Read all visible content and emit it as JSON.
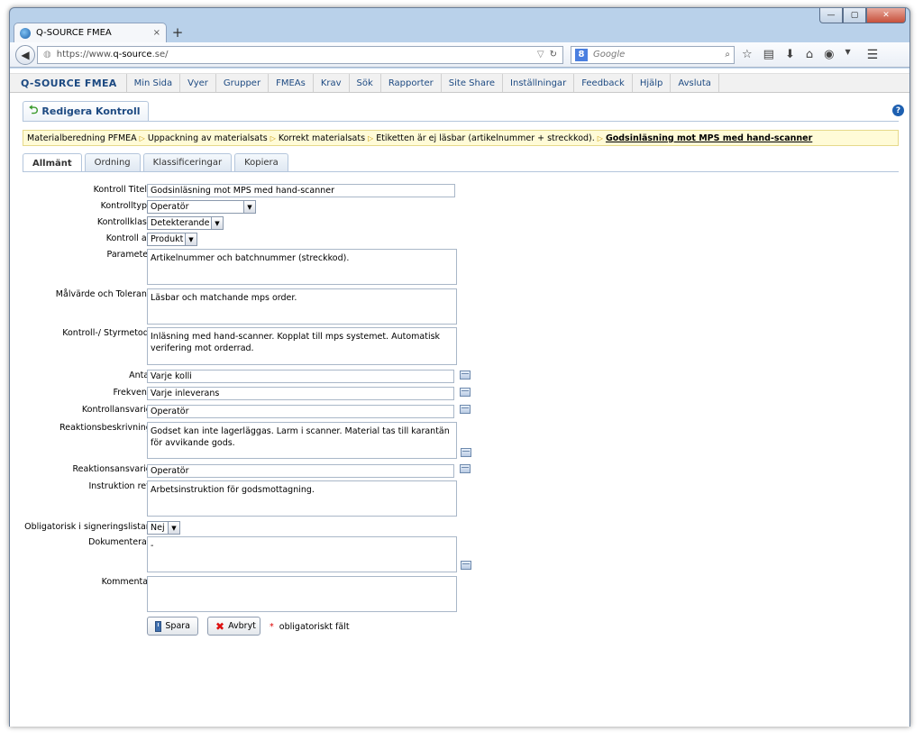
{
  "browser": {
    "tab_title": "Q-SOURCE FMEA",
    "tab_close": "×",
    "new_tab": "+",
    "url_prefix": "https://www.",
    "url_domain": "q-source",
    "url_suffix": ".se/",
    "search_placeholder": "Google",
    "search_engine_letter": "8"
  },
  "appmenu": {
    "brand": "Q-SOURCE FMEA",
    "items": [
      "Min Sida",
      "Vyer",
      "Grupper",
      "FMEAs",
      "Krav",
      "Sök",
      "Rapporter",
      "Site Share",
      "Inställningar",
      "Feedback",
      "Hjälp",
      "Avsluta"
    ]
  },
  "header": {
    "title": "Redigera Kontroll",
    "help": "?"
  },
  "breadcrumb": {
    "items": [
      "Materialberedning PFMEA",
      "Uppackning av materialsats",
      "Korrekt materialsats",
      "Etiketten är ej läsbar (artikelnummer + streckkod)."
    ],
    "current": "Godsinläsning mot MPS med hand-scanner"
  },
  "tabs": [
    "Allmänt",
    "Ordning",
    "Klassificeringar",
    "Kopiera"
  ],
  "form": {
    "title_label": "Kontroll Titel:",
    "title_value": "Godsinläsning mot MPS med hand-scanner",
    "type_label": "Kontrolltyp:",
    "type_value": "Operatör",
    "class_label": "Kontrollklass:",
    "class_value": "Detekterande",
    "by_label": "Kontroll av:",
    "by_value": "Produkt",
    "param_label": "Parameter:",
    "param_value": "Artikelnummer och batchnummer (streckkod).",
    "target_label": "Målvärde och Tolerans:",
    "target_value": "Läsbar och matchande mps order.",
    "method_label": "Kontroll-/ Styrmetod :",
    "method_value": "Inläsning med hand-scanner. Kopplat till mps systemet. Automatisk verifering mot orderrad.",
    "amount_label": "Antal:",
    "amount_value": "Varje kolli",
    "freq_label": "Frekvens:",
    "freq_value": "Varje inleverans",
    "resp_label": "Kontrollansvarig:",
    "resp_value": "Operatör",
    "reaction_label": "Reaktionsbeskrivning:",
    "reaction_value": "Godset kan inte lagerläggas. Larm i scanner. Material tas till karantän för avvikande gods.",
    "reaction_resp_label": "Reaktionsansvarig:",
    "reaction_resp_value": "Operatör",
    "instr_label": "Instruktion ref.:",
    "instr_value": "Arbetsinstruktion för godsmottagning.",
    "mandatory_label": "Obligatorisk i signeringslistan:",
    "mandatory_value": "Nej",
    "doc_label": "Dokumenteras:",
    "doc_value": "-",
    "comment_label": "Kommentar:",
    "comment_value": "",
    "required_mark": "*"
  },
  "actions": {
    "save": "Spara",
    "cancel": "Avbryt",
    "required_note": "obligatoriskt fält"
  }
}
